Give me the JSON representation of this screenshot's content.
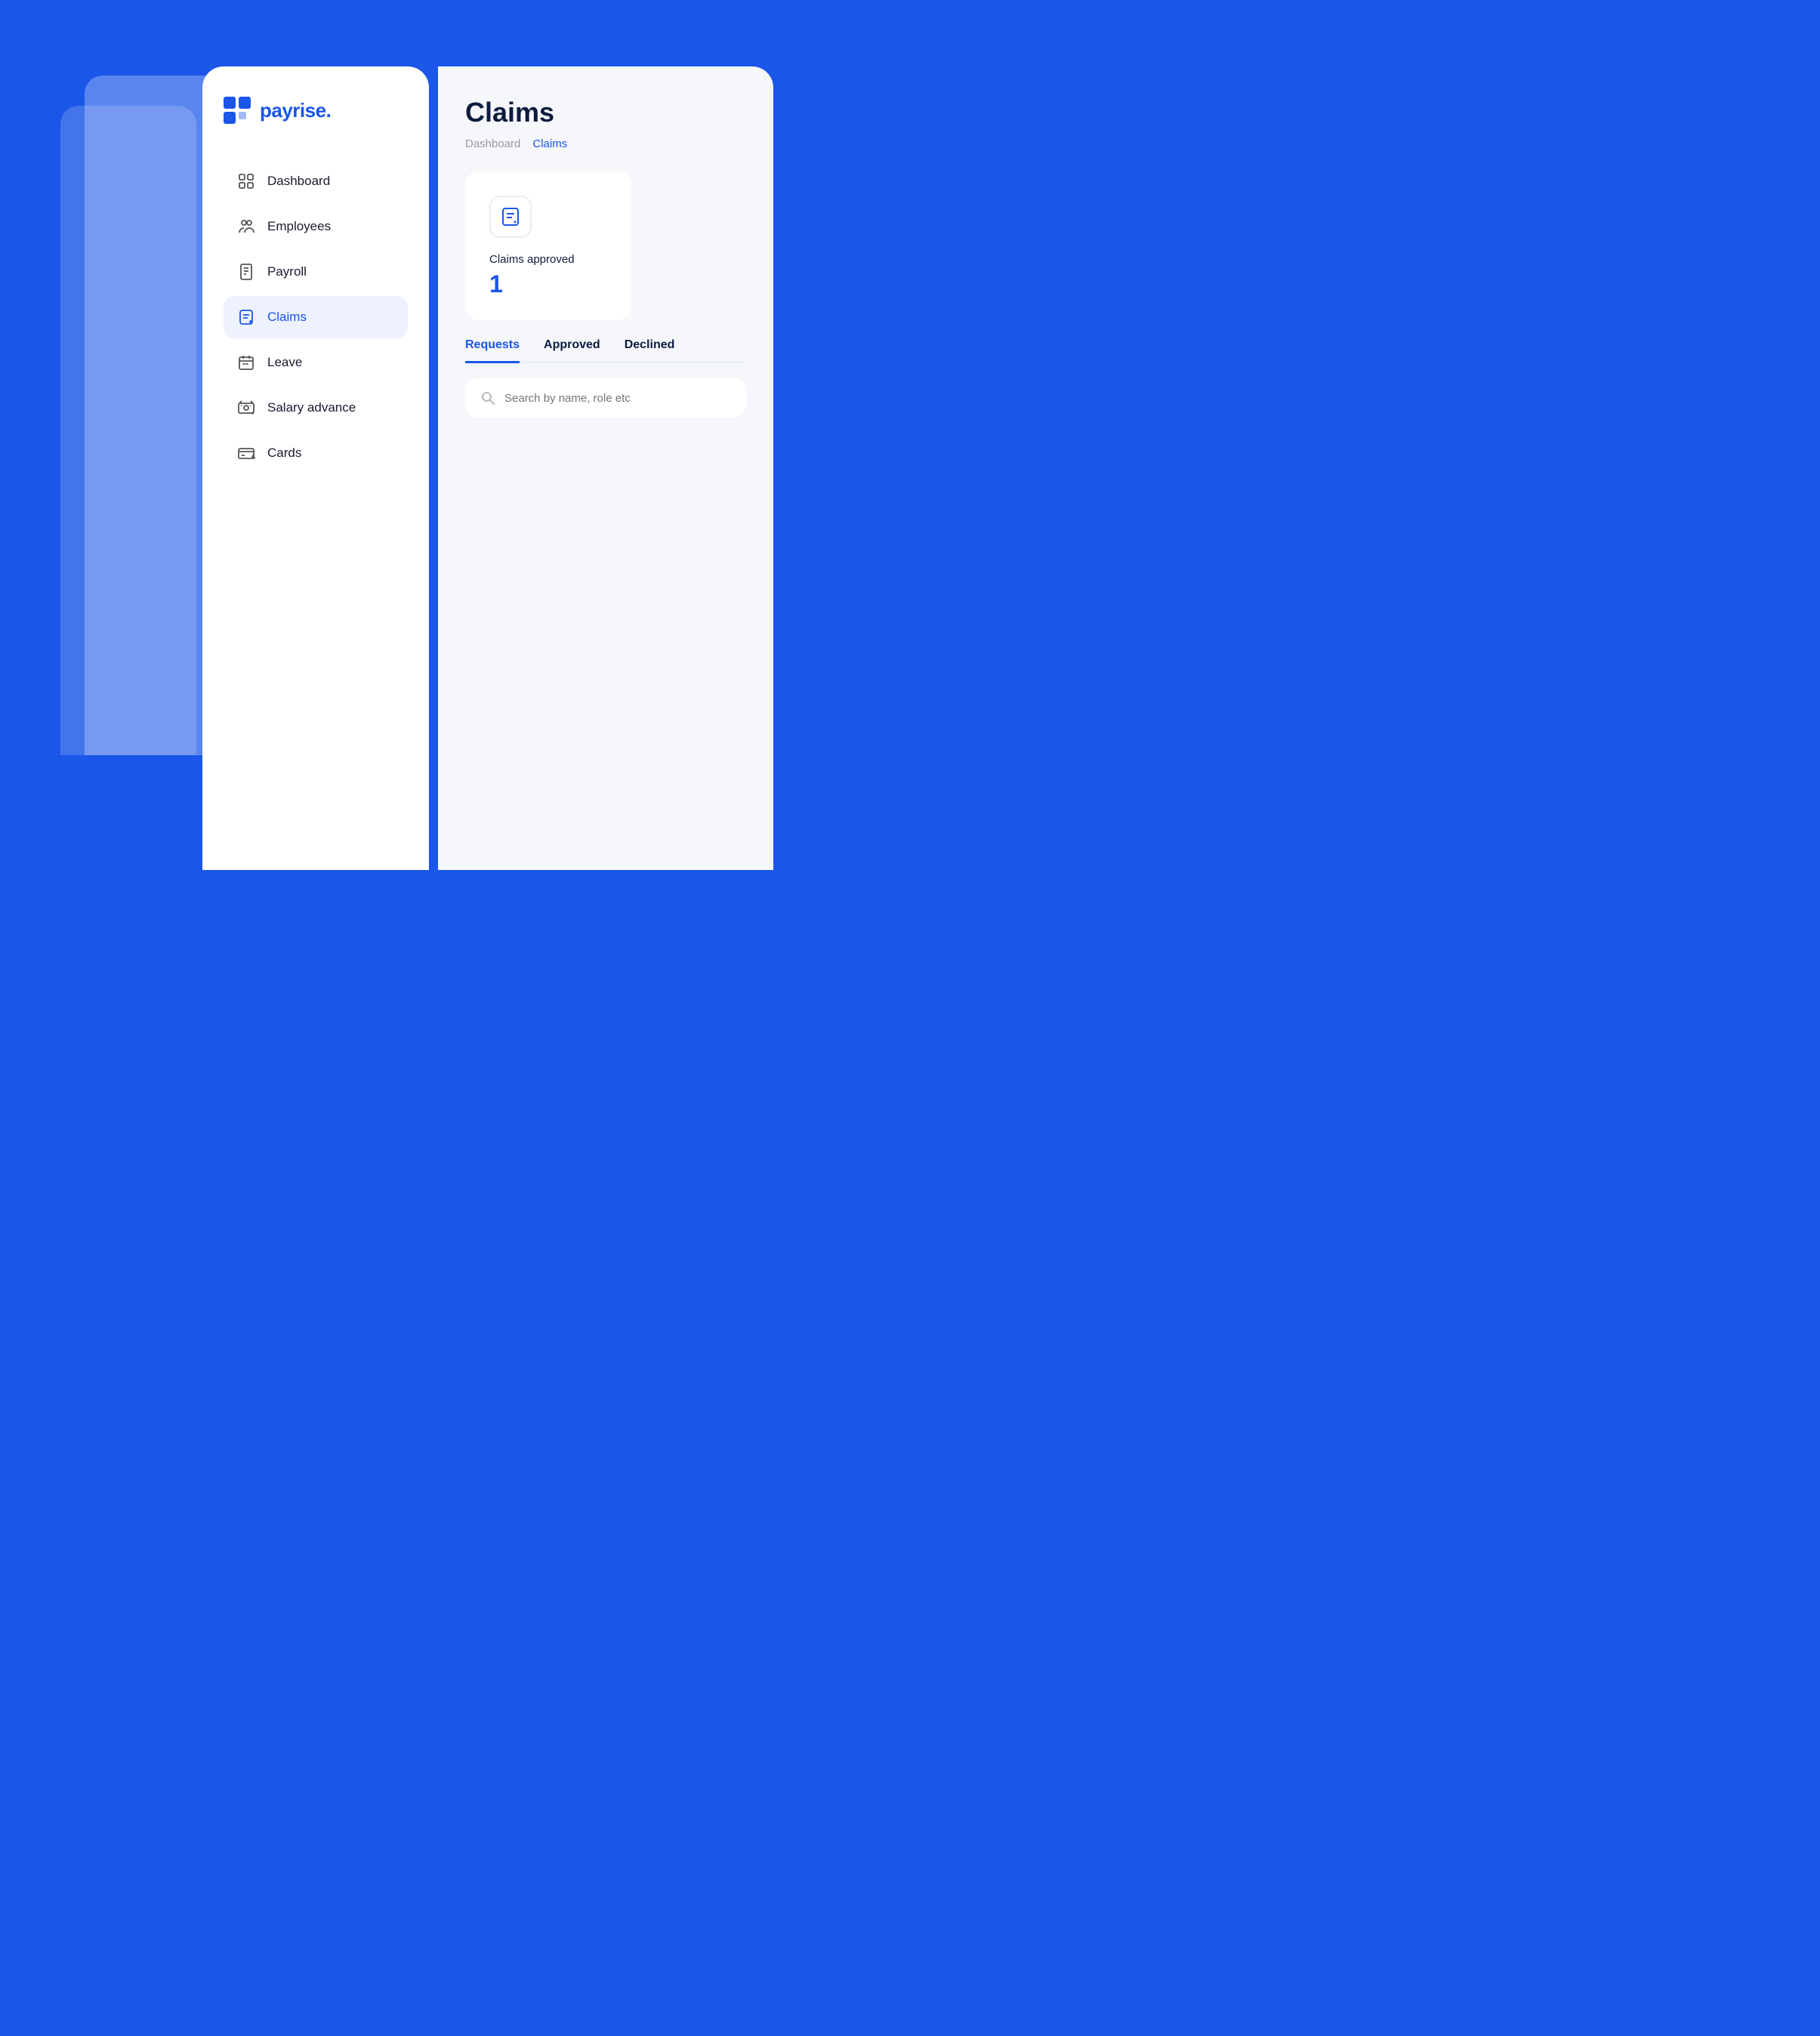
{
  "logo": {
    "text": "payrise."
  },
  "nav": {
    "items": [
      {
        "id": "dashboard",
        "label": "Dashboard",
        "icon": "dashboard-icon",
        "active": false
      },
      {
        "id": "employees",
        "label": "Employees",
        "icon": "employees-icon",
        "active": false
      },
      {
        "id": "payroll",
        "label": "Payroll",
        "icon": "payroll-icon",
        "active": false
      },
      {
        "id": "claims",
        "label": "Claims",
        "icon": "claims-icon",
        "active": true
      },
      {
        "id": "leave",
        "label": "Leave",
        "icon": "leave-icon",
        "active": false
      },
      {
        "id": "salary-advance",
        "label": "Salary advance",
        "icon": "salary-advance-icon",
        "active": false
      },
      {
        "id": "cards",
        "label": "Cards",
        "icon": "cards-icon",
        "active": false
      }
    ]
  },
  "content": {
    "page_title": "Claims",
    "breadcrumbs": [
      {
        "label": "Dashboard",
        "active": false
      },
      {
        "label": "Claims",
        "active": true
      }
    ],
    "stats": {
      "icon": "claims-stats-icon",
      "label": "Claims approved",
      "value": "1"
    },
    "tabs": [
      {
        "label": "Requests",
        "active": true
      },
      {
        "label": "Approved",
        "active": false
      },
      {
        "label": "Declined",
        "active": false
      }
    ],
    "search": {
      "placeholder": "Search by name, role etc"
    }
  }
}
